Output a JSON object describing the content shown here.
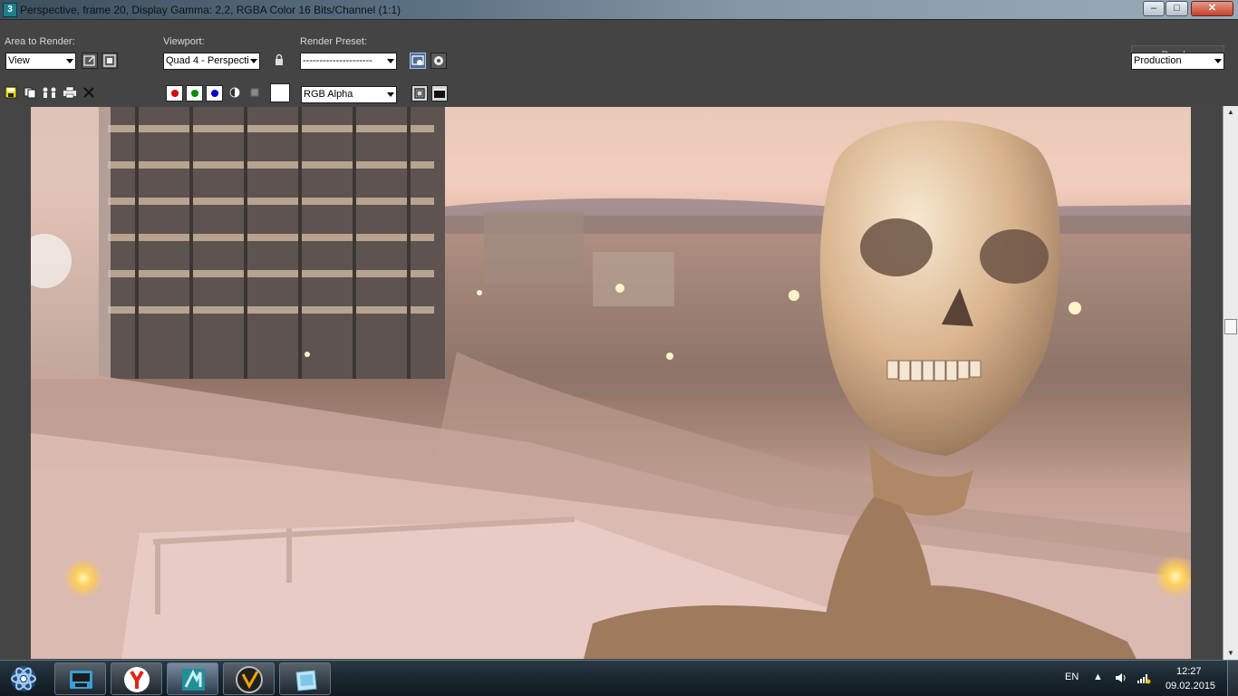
{
  "window": {
    "title": "Perspective, frame 20, Display Gamma: 2,2, RGBA Color 16 Bits/Channel (1:1)",
    "minimize_icon": "–",
    "maximize_icon": "□",
    "close_icon": "✕"
  },
  "toolbar": {
    "area_label": "Area to Render:",
    "area_value": "View",
    "viewport_label": "Viewport:",
    "viewport_value": "Quad 4 - Perspecti",
    "preset_label": "Render Preset:",
    "preset_value": "---------------------",
    "render_label": "Render",
    "production_value": "Production",
    "channel_value": "RGB Alpha"
  },
  "channels": {
    "red": "#d80000",
    "green": "#008a00",
    "blue": "#0000d0"
  },
  "taskbar": {
    "language": "EN",
    "time": "12:27",
    "date": "09.02.2015"
  }
}
